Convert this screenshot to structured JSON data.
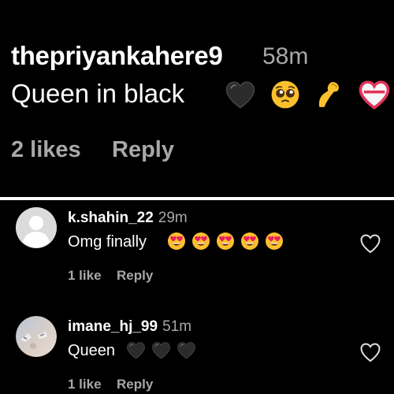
{
  "top_comment": {
    "username": "thepriyankahere9",
    "time": "58m",
    "text": "Queen in black",
    "emojis": [
      "black-heart",
      "pleading-face",
      "pinching-hand",
      "white-heart"
    ],
    "likes": "2 likes",
    "reply": "Reply"
  },
  "comments": [
    {
      "username": "k.shahin_22",
      "time": "29m",
      "text": "Omg finally",
      "emojis": [
        "heart-eyes",
        "heart-eyes",
        "heart-eyes",
        "heart-eyes",
        "heart-eyes"
      ],
      "likes": "1 like",
      "reply": "Reply",
      "avatar": "default-avatar"
    },
    {
      "username": "imane_hj_99",
      "time": "51m",
      "text": "Queen",
      "emojis": [
        "black-heart",
        "black-heart",
        "black-heart"
      ],
      "likes": "1 like",
      "reply": "Reply",
      "avatar": "photo-avatar"
    }
  ],
  "colors": {
    "background": "#000000",
    "text": "#ffffff",
    "secondary_text": "#a8a8a8",
    "divider": "#ffffff"
  }
}
